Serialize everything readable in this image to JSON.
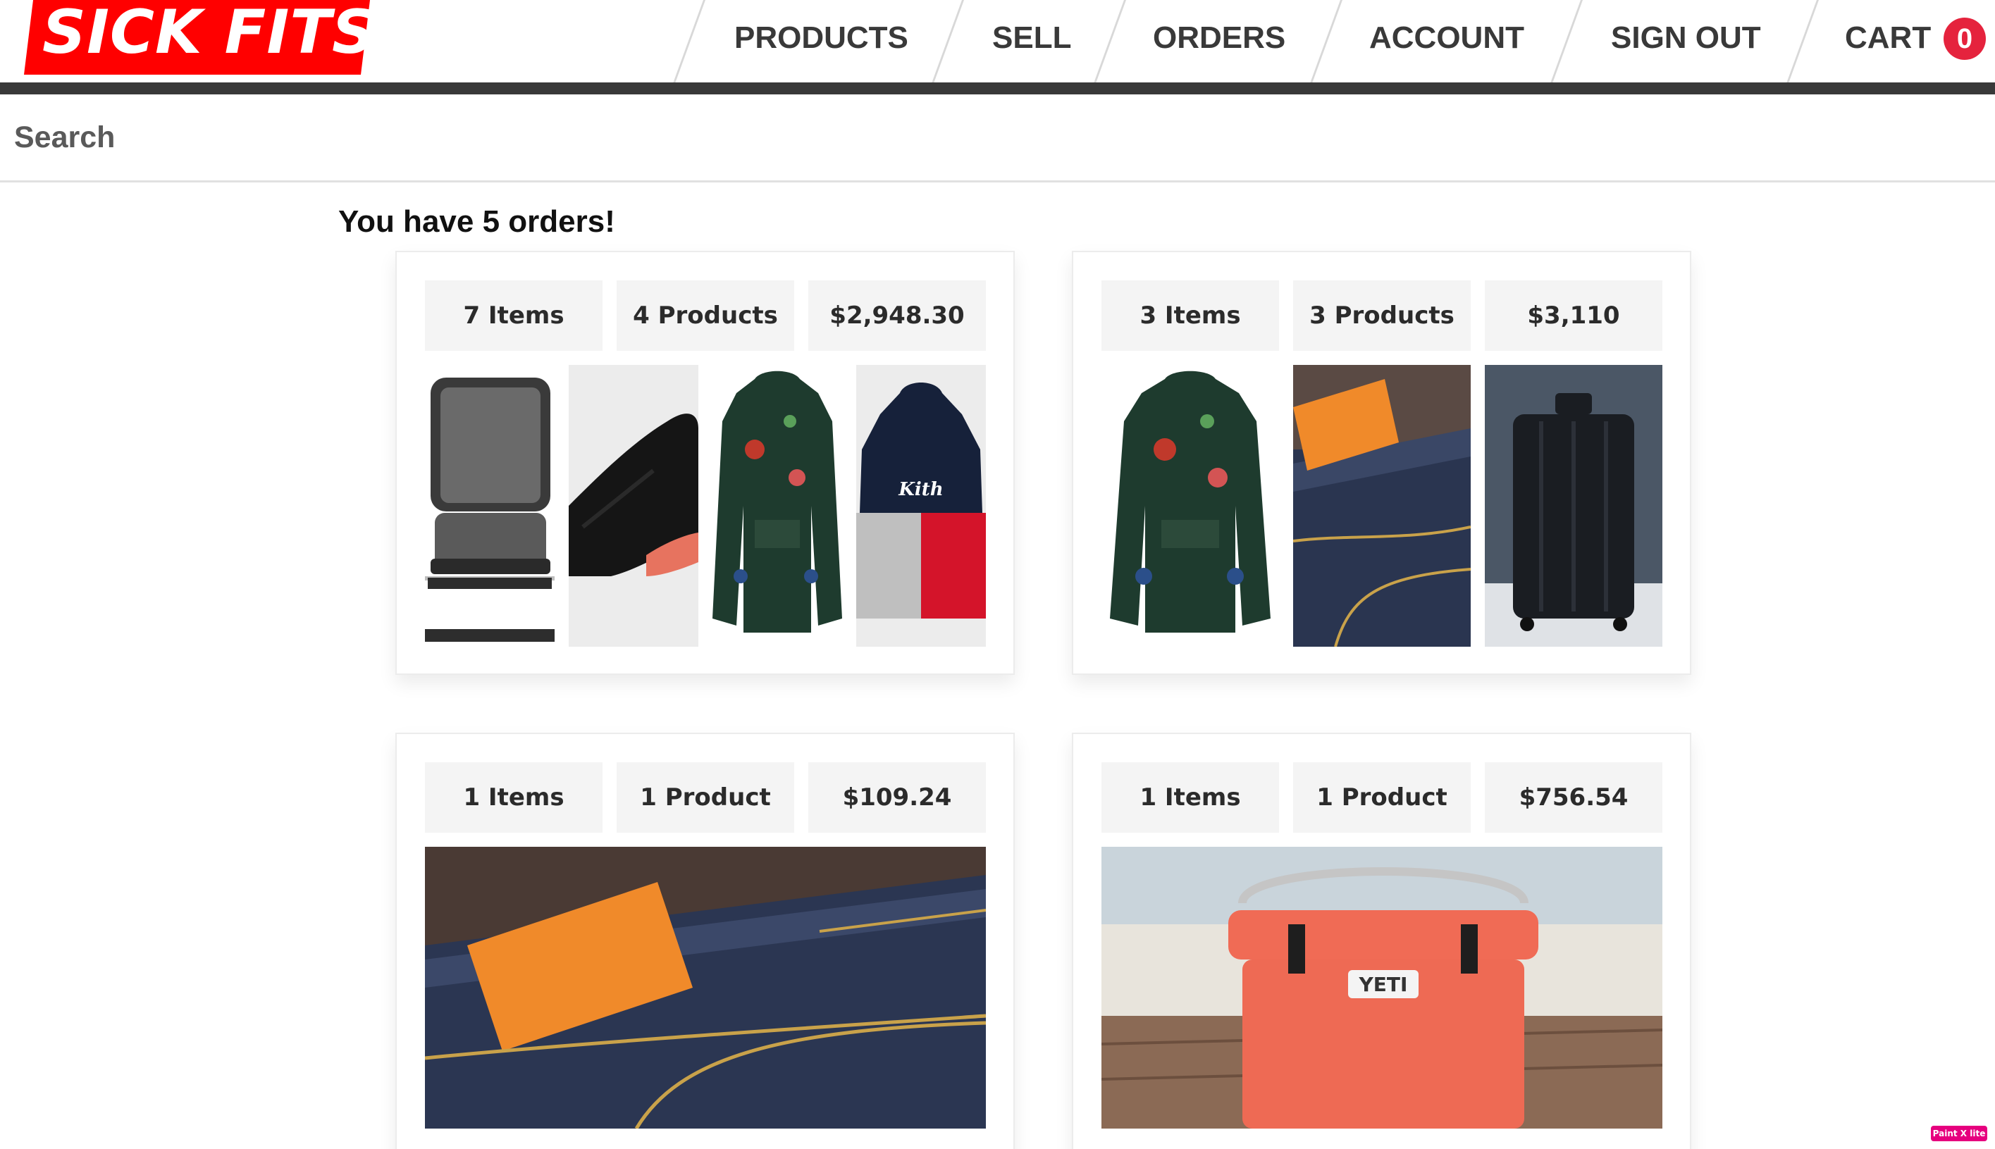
{
  "header": {
    "logo_text": "SICK FITS",
    "nav": [
      "PRODUCTS",
      "SELL",
      "ORDERS",
      "ACCOUNT",
      "SIGN OUT"
    ],
    "cart_label": "CART",
    "cart_count": "0"
  },
  "search": {
    "placeholder": "Search"
  },
  "main": {
    "heading": "You have 5 orders!",
    "orders": [
      {
        "items": "7 Items",
        "products": "4 Products",
        "total": "$2,948.30",
        "images": [
          "chair",
          "black-sneaker",
          "floral-anorak",
          "kith-hoodie"
        ]
      },
      {
        "items": "3 Items",
        "products": "3 Products",
        "total": "$3,110",
        "images": [
          "floral-anorak",
          "denim-jeans",
          "black-suitcase"
        ]
      },
      {
        "items": "1 Items",
        "products": "1 Product",
        "total": "$109.24",
        "images": [
          "denim-jeans"
        ]
      },
      {
        "items": "1 Items",
        "products": "1 Product",
        "total": "$756.54",
        "images": [
          "yeti-cooler"
        ]
      }
    ]
  },
  "badge": {
    "text": "Paint X lite"
  },
  "colors": {
    "brand_red": "#ff0000",
    "cart_badge": "#e5233d",
    "text_dark": "#393939",
    "header_bar": "#393939"
  }
}
